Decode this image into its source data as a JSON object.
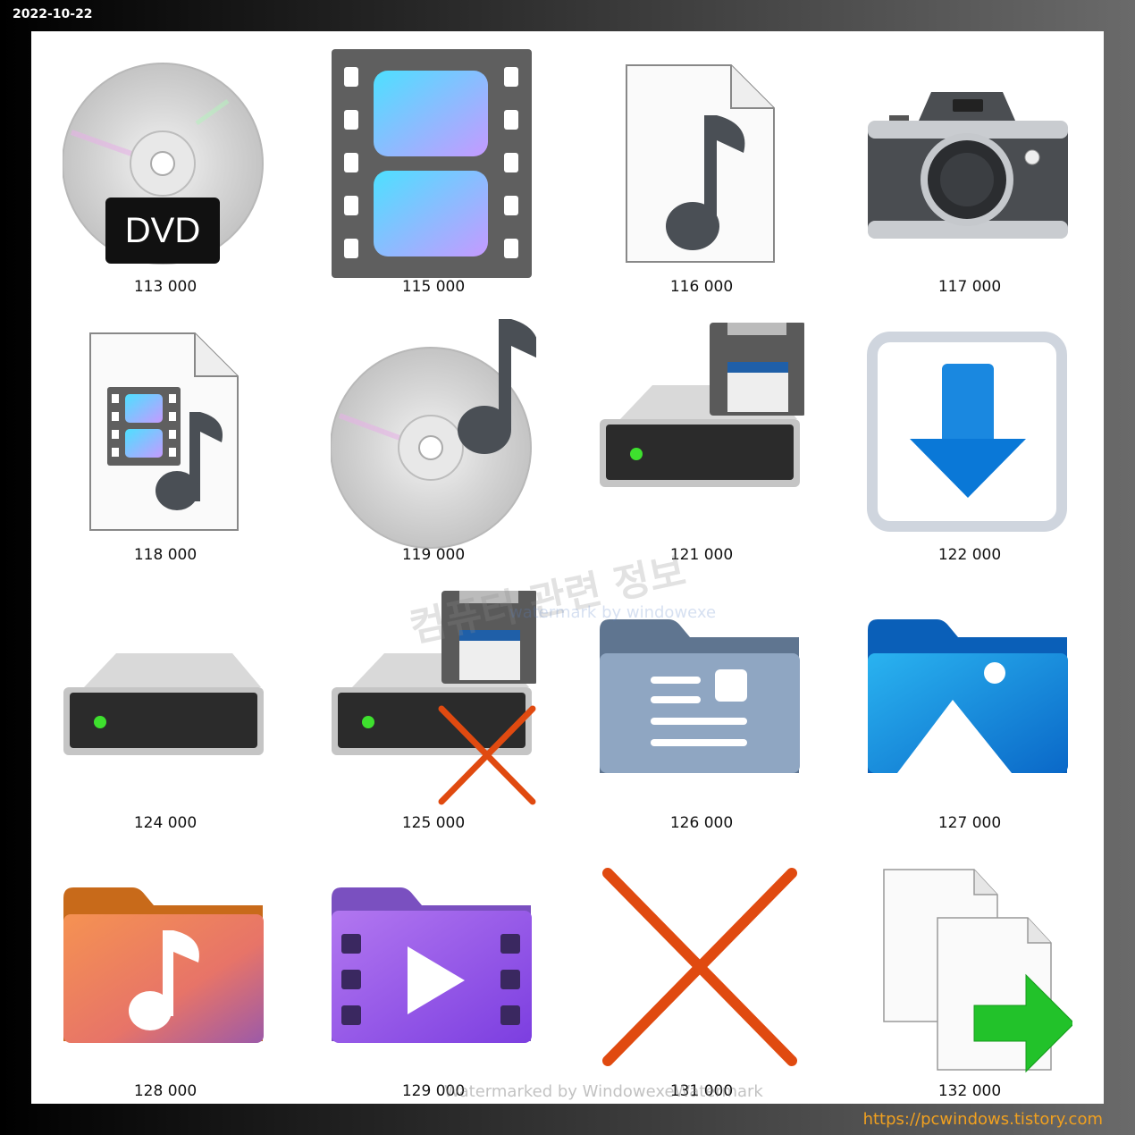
{
  "header": {
    "date": "2022-10-22"
  },
  "icons": [
    {
      "label": "113 000",
      "icon": "dvd-disc-icon",
      "badge": "DVD"
    },
    {
      "label": "115 000",
      "icon": "film-strip-icon"
    },
    {
      "label": "116 000",
      "icon": "audio-file-icon"
    },
    {
      "label": "117 000",
      "icon": "camera-icon"
    },
    {
      "label": "118 000",
      "icon": "media-file-icon"
    },
    {
      "label": "119 000",
      "icon": "music-cd-icon"
    },
    {
      "label": "121 000",
      "icon": "floppy-drive-icon"
    },
    {
      "label": "122 000",
      "icon": "download-arrow-icon"
    },
    {
      "label": "124 000",
      "icon": "hard-drive-icon"
    },
    {
      "label": "125 000",
      "icon": "floppy-drive-error-icon"
    },
    {
      "label": "126 000",
      "icon": "contact-folder-icon"
    },
    {
      "label": "127 000",
      "icon": "pictures-folder-icon"
    },
    {
      "label": "128 000",
      "icon": "music-folder-icon"
    },
    {
      "label": "129 000",
      "icon": "videos-folder-icon"
    },
    {
      "label": "131 000",
      "icon": "red-x-icon"
    },
    {
      "label": "132 000",
      "icon": "copy-files-icon"
    }
  ],
  "watermarks": {
    "korean": "컴퓨터 관련 정보",
    "english": "watermark by windowexe",
    "bottom": "Watermarked by WindowexeWatermark"
  },
  "footer": {
    "site": "https://pcwindows.tistory.com"
  },
  "colors": {
    "accent_blue": "#0a78d7",
    "red_x": "#e04a10",
    "green_arrow": "#22c22a",
    "link_orange": "#f0a020"
  }
}
